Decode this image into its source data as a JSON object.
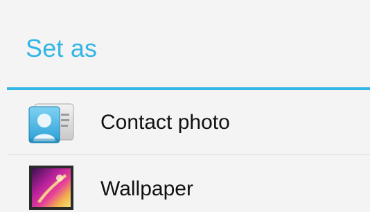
{
  "dialog": {
    "title": "Set as",
    "accent_color": "#33b5e5",
    "items": [
      {
        "label": "Contact photo",
        "icon": "contact-card-icon"
      },
      {
        "label": "Wallpaper",
        "icon": "wallpaper-picture-icon"
      }
    ]
  }
}
